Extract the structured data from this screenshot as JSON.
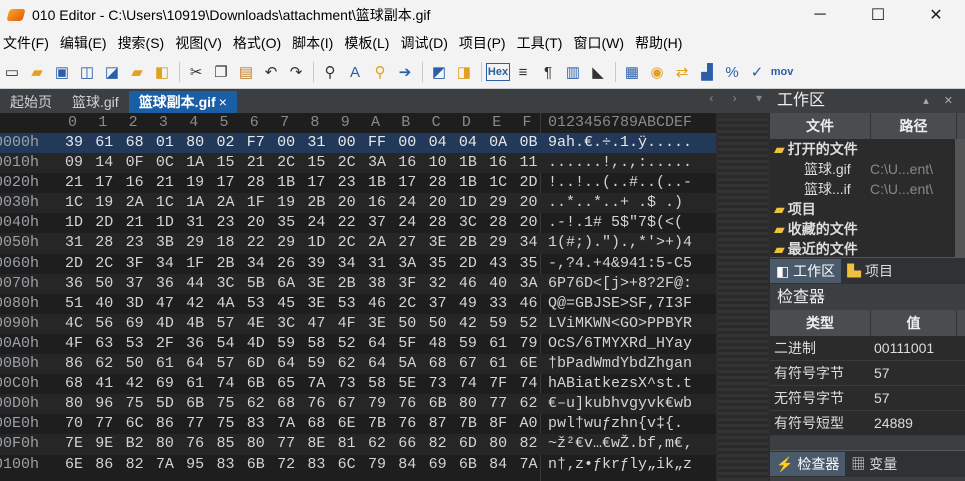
{
  "window": {
    "title": "010 Editor - C:\\Users\\10919\\Downloads\\attachment\\篮球副本.gif",
    "minimize": "─",
    "maximize": "☐",
    "close": "✕"
  },
  "menu": [
    "文件(F)",
    "编辑(E)",
    "搜索(S)",
    "视图(V)",
    "格式(O)",
    "脚本(I)",
    "模板(L)",
    "调试(D)",
    "项目(P)",
    "工具(T)",
    "窗口(W)",
    "帮助(H)"
  ],
  "toolbar": {
    "icons": [
      "new-file-icon",
      "open-icon",
      "save-icon",
      "save-as-icon",
      "save-all-icon",
      "open-folder-icon",
      "open-project-icon",
      "cut-icon",
      "copy-icon",
      "paste-icon",
      "undo-icon",
      "redo-icon",
      "find-icon",
      "replace-icon",
      "find-in-files-icon",
      "goto-icon",
      "hex-text-icon",
      "edit-as-icon",
      "text-hex-icon",
      "hex-icon",
      "column-mode-icon",
      "show-whitespace-icon",
      "bookmark-icon",
      "marker-icon",
      "calculator-icon",
      "template-icon",
      "compare-icon",
      "histogram-icon",
      "percent-icon",
      "checksum-icon",
      "mov-icon"
    ],
    "hex_label": "Hex",
    "mov_label": "mov"
  },
  "tabs": [
    {
      "label": "起始页",
      "active": false
    },
    {
      "label": "篮球.gif",
      "active": false
    },
    {
      "label": "篮球副本.gif",
      "active": true,
      "close": "×"
    }
  ],
  "tab_nav": "‹ › ▾",
  "hex": {
    "columns": [
      "0",
      "1",
      "2",
      "3",
      "4",
      "5",
      "6",
      "7",
      "8",
      "9",
      "A",
      "B",
      "C",
      "D",
      "E",
      "F"
    ],
    "ascii_header": "0123456789ABCDEF",
    "rows": [
      {
        "addr": "0000h",
        "bytes": [
          "39",
          "61",
          "68",
          "01",
          "80",
          "02",
          "F7",
          "00",
          "31",
          "00",
          "FF",
          "00",
          "04",
          "04",
          "0A",
          "0B"
        ],
        "ascii": "9ah.€.÷.1.ÿ.....",
        "selected": true
      },
      {
        "addr": "0010h",
        "bytes": [
          "09",
          "14",
          "0F",
          "0C",
          "1A",
          "15",
          "21",
          "2C",
          "15",
          "2C",
          "3A",
          "16",
          "10",
          "1B",
          "16",
          "11"
        ],
        "ascii": "......!,.,:.....",
        "selected": false
      },
      {
        "addr": "0020h",
        "bytes": [
          "21",
          "17",
          "16",
          "21",
          "19",
          "17",
          "28",
          "1B",
          "17",
          "23",
          "1B",
          "17",
          "28",
          "1B",
          "1C",
          "2D"
        ],
        "ascii": "!..!..(..#..(..-",
        "selected": false
      },
      {
        "addr": "0030h",
        "bytes": [
          "1C",
          "19",
          "2A",
          "1C",
          "1A",
          "2A",
          "1F",
          "19",
          "2B",
          "20",
          "16",
          "24",
          "20",
          "1D",
          "29",
          "20"
        ],
        "ascii": "..*..*..+ .$ .) ",
        "selected": false
      },
      {
        "addr": "0040h",
        "bytes": [
          "1D",
          "2D",
          "21",
          "1D",
          "31",
          "23",
          "20",
          "35",
          "24",
          "22",
          "37",
          "24",
          "28",
          "3C",
          "28",
          "20"
        ],
        "ascii": ".-!.1# 5$\"7$(<( ",
        "selected": false
      },
      {
        "addr": "0050h",
        "bytes": [
          "31",
          "28",
          "23",
          "3B",
          "29",
          "18",
          "22",
          "29",
          "1D",
          "2C",
          "2A",
          "27",
          "3E",
          "2B",
          "29",
          "34"
        ],
        "ascii": "1(#;).\").,*'>+)4",
        "selected": false
      },
      {
        "addr": "0060h",
        "bytes": [
          "2D",
          "2C",
          "3F",
          "34",
          "1F",
          "2B",
          "34",
          "26",
          "39",
          "34",
          "31",
          "3A",
          "35",
          "2D",
          "43",
          "35"
        ],
        "ascii": "-,?4.+4&941:5-C5",
        "selected": false
      },
      {
        "addr": "0070h",
        "bytes": [
          "36",
          "50",
          "37",
          "36",
          "44",
          "3C",
          "5B",
          "6A",
          "3E",
          "2B",
          "38",
          "3F",
          "32",
          "46",
          "40",
          "3A"
        ],
        "ascii": "6P76D<[j>+8?2F@:",
        "selected": false
      },
      {
        "addr": "0080h",
        "bytes": [
          "51",
          "40",
          "3D",
          "47",
          "42",
          "4A",
          "53",
          "45",
          "3E",
          "53",
          "46",
          "2C",
          "37",
          "49",
          "33",
          "46"
        ],
        "ascii": "Q@=GBJSE>SF,7I3F",
        "selected": false
      },
      {
        "addr": "0090h",
        "bytes": [
          "4C",
          "56",
          "69",
          "4D",
          "4B",
          "57",
          "4E",
          "3C",
          "47",
          "4F",
          "3E",
          "50",
          "50",
          "42",
          "59",
          "52"
        ],
        "ascii": "LViMKWN<GO>PPBYR",
        "selected": false
      },
      {
        "addr": "00A0h",
        "bytes": [
          "4F",
          "63",
          "53",
          "2F",
          "36",
          "54",
          "4D",
          "59",
          "58",
          "52",
          "64",
          "5F",
          "48",
          "59",
          "61",
          "79"
        ],
        "ascii": "OcS/6TMYXRd_HYay",
        "selected": false
      },
      {
        "addr": "00B0h",
        "bytes": [
          "86",
          "62",
          "50",
          "61",
          "64",
          "57",
          "6D",
          "64",
          "59",
          "62",
          "64",
          "5A",
          "68",
          "67",
          "61",
          "6E"
        ],
        "ascii": "†bPadWmdYbdZhgan",
        "selected": false
      },
      {
        "addr": "00C0h",
        "bytes": [
          "68",
          "41",
          "42",
          "69",
          "61",
          "74",
          "6B",
          "65",
          "7A",
          "73",
          "58",
          "5E",
          "73",
          "74",
          "7F",
          "74"
        ],
        "ascii": "hABiatkezsX^st.t",
        "selected": false
      },
      {
        "addr": "00D0h",
        "bytes": [
          "80",
          "96",
          "75",
          "5D",
          "6B",
          "75",
          "62",
          "68",
          "76",
          "67",
          "79",
          "76",
          "6B",
          "80",
          "77",
          "62"
        ],
        "ascii": "€–u]kubhvgyvk€wb",
        "selected": false
      },
      {
        "addr": "00E0h",
        "bytes": [
          "70",
          "77",
          "6C",
          "86",
          "77",
          "75",
          "83",
          "7A",
          "68",
          "6E",
          "7B",
          "76",
          "87",
          "7B",
          "8F",
          "A0"
        ],
        "ascii": "pwl†wuƒzhn{v‡{. ",
        "selected": false
      },
      {
        "addr": "00F0h",
        "bytes": [
          "7E",
          "9E",
          "B2",
          "80",
          "76",
          "85",
          "80",
          "77",
          "8E",
          "81",
          "62",
          "66",
          "82",
          "6D",
          "80",
          "82"
        ],
        "ascii": "~ž²€v…€wŽ.bf‚m€‚",
        "selected": false
      },
      {
        "addr": "0100h",
        "bytes": [
          "6E",
          "86",
          "82",
          "7A",
          "95",
          "83",
          "6B",
          "72",
          "83",
          "6C",
          "79",
          "84",
          "69",
          "6B",
          "84",
          "7A"
        ],
        "ascii": "n†‚z•ƒkrƒly„ik„z",
        "selected": false
      }
    ]
  },
  "workspace": {
    "title": "工作区",
    "col_file": "文件",
    "col_path": "路径",
    "tree": [
      {
        "label": "打开的文件",
        "kind": "folder",
        "path": ""
      },
      {
        "label": "篮球.gif",
        "kind": "file",
        "path": "C:\\U...ent\\"
      },
      {
        "label": "篮球...if",
        "kind": "file",
        "path": "C:\\U...ent\\"
      },
      {
        "label": "项目",
        "kind": "folder",
        "path": ""
      },
      {
        "label": "收藏的文件",
        "kind": "folder",
        "path": ""
      },
      {
        "label": "最近的文件",
        "kind": "folder",
        "path": ""
      }
    ],
    "tabs": [
      "工作区",
      "项目"
    ]
  },
  "inspector": {
    "title": "检查器",
    "col_type": "类型",
    "col_value": "值",
    "rows": [
      {
        "type": "二进制",
        "value": "00111001"
      },
      {
        "type": "有符号字节",
        "value": "57"
      },
      {
        "type": "无符号字节",
        "value": "57"
      },
      {
        "type": "有符号短型",
        "value": "24889"
      }
    ],
    "tabs": [
      "检查器",
      "变量"
    ]
  },
  "colors": {
    "accent": "#1a5fa6",
    "background": "#1e1e1e",
    "selection": "#23395a"
  }
}
